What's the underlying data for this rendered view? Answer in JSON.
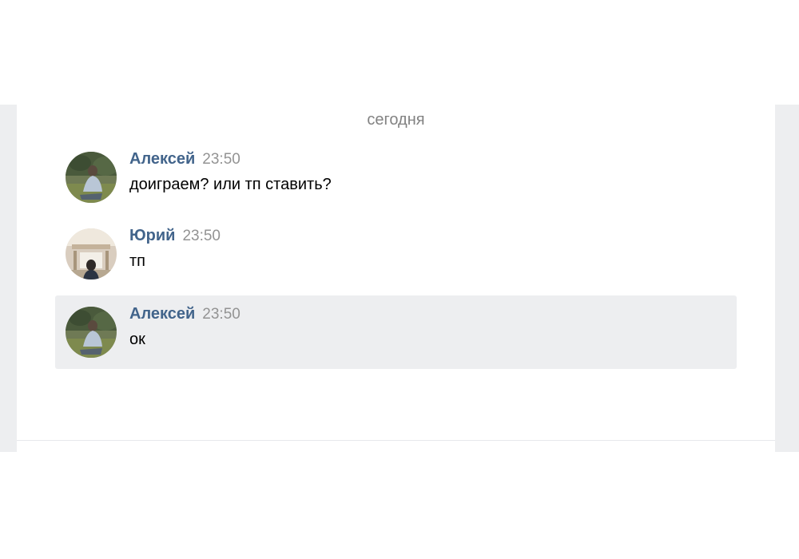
{
  "chat": {
    "date_separator": "сегодня",
    "messages": [
      {
        "author": "Алексей",
        "time": "23:50",
        "text": "доиграем? или тп ставить?",
        "avatar": "avatar-aleksey-photo",
        "selected": false
      },
      {
        "author": "Юрий",
        "time": "23:50",
        "text": "тп",
        "avatar": "avatar-yuriy-photo",
        "selected": false
      },
      {
        "author": "Алексей",
        "time": "23:50",
        "text": "ок",
        "avatar": "avatar-aleksey-photo",
        "selected": true
      }
    ]
  },
  "colors": {
    "author_link": "#42648b",
    "time": "#939393",
    "selected_bg": "#edeef0",
    "page_bg": "#edeef0"
  }
}
